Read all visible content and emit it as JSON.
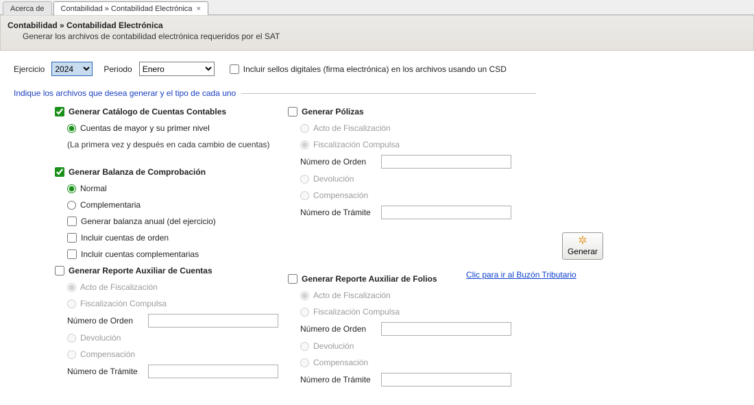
{
  "tabs": {
    "about": "Acerca de",
    "active": "Contabilidad » Contabilidad Electrónica"
  },
  "header": {
    "title": "Contabilidad » Contabilidad Electrónica",
    "subtitle": "Generar los archivos de contabilidad electrónica requeridos por el SAT"
  },
  "top": {
    "ejercicio_label": "Ejercicio",
    "ejercicio_value": "2024",
    "periodo_label": "Periodo",
    "periodo_value": "Enero",
    "incluir_csd": "Incluir sellos digitales (firma electrónica) en los archivos usando un CSD"
  },
  "legend": "Indique los archivos que desea generar y el tipo de cada uno",
  "catalogo": {
    "title": "Generar Catálogo de Cuentas Contables",
    "opt1": "Cuentas de mayor y su primer nivel",
    "hint": "(La primera vez y después en cada cambio de cuentas)"
  },
  "balanza": {
    "title": "Generar Balanza de Comprobación",
    "normal": "Normal",
    "comp": "Complementaria",
    "anual": "Generar balanza anual (del ejercicio)",
    "orden": "Incluir cuentas de orden",
    "complem": "Incluir cuentas complementarias"
  },
  "aux_cuentas": {
    "title": "Generar Reporte Auxiliar de Cuentas",
    "fiscal": "Acto de Fiscalización",
    "comps": "Fiscalización Compulsa",
    "norden": "Número de Orden",
    "devol": "Devolución",
    "compens": "Compensación",
    "ntram": "Número de Trámite"
  },
  "polizas": {
    "title": "Generar Pólizas",
    "fiscal": "Acto de Fiscalización",
    "comps": "Fiscalización Compulsa",
    "norden": "Número de Orden",
    "devol": "Devolución",
    "compens": "Compensación",
    "ntram": "Número de Trámite"
  },
  "aux_folios": {
    "title": "Generar Reporte Auxiliar de Folios",
    "fiscal": "Acto de Fiscalización",
    "comps": "Fiscalización Compulsa",
    "norden": "Número de Orden",
    "devol": "Devolución",
    "compens": "Compensación",
    "ntram": "Número de Trámite"
  },
  "actions": {
    "generar": "Generar",
    "buzon": "Clic para ir al Buzón Tributario"
  }
}
